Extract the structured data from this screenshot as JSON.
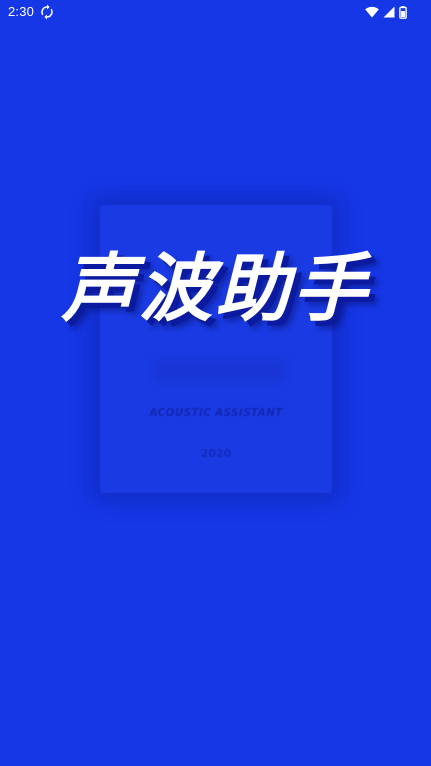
{
  "colors": {
    "background": "#1637E6",
    "card": "#1A3BE3",
    "status_icons": "#FFFFFF",
    "title_text": "#FFFFFF",
    "title_shadow": "#0B1A9E"
  },
  "status_bar": {
    "time": "2:30",
    "icons": [
      "sync-icon",
      "wifi-icon",
      "signal-icon",
      "battery-icon"
    ]
  },
  "splash": {
    "title": "声波助手",
    "subtitle": "ACOUSTIC ASSISTANT",
    "year": "2020"
  }
}
